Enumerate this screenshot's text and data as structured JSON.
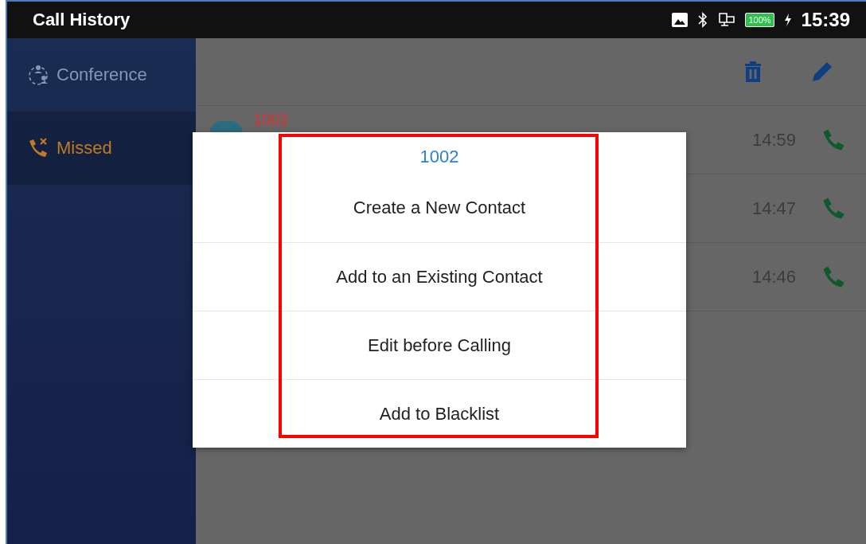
{
  "status_bar": {
    "title": "Call History",
    "battery": "100%",
    "time": "15:39"
  },
  "sidebar": {
    "items": [
      {
        "label": "Conference",
        "kind": "conference",
        "selected": false
      },
      {
        "label": "Missed",
        "kind": "missed",
        "selected": true
      }
    ]
  },
  "calls": [
    {
      "number": "1002",
      "time": "14:59"
    },
    {
      "time": "14:47"
    },
    {
      "time": "14:46"
    }
  ],
  "dialog": {
    "title": "1002",
    "options": [
      "Create a New Contact",
      "Add to an Existing Contact",
      "Edit before Calling",
      "Add to Blacklist"
    ],
    "highlighted": true
  }
}
